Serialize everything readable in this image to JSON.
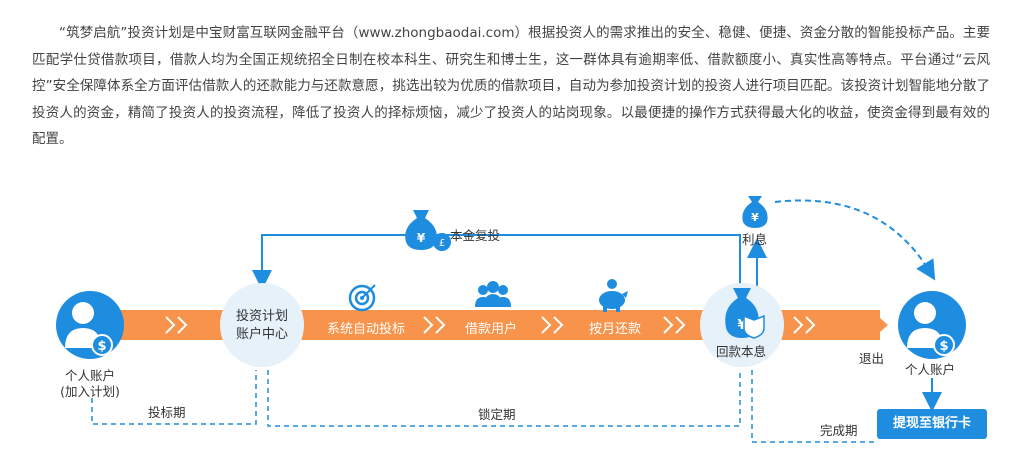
{
  "intro": "“筑梦启航”投资计划是中宝财富互联网金融平台（www.zhongbaodai.com）根据投资人的需求推出的安全、稳健、便捷、资金分散的智能投标产品。主要匹配学仕贷借款项目，借款人均为全国正规统招全日制在校本科生、研究生和博士生，这一群体具有逾期率低、借款额度小、真实性高等特点。平台通过“云风控”安全保障体系全方面评估借款人的还款能力与还款意愿，挑选出较为优质的借款项目，自动为参加投资计划的投资人进行项目匹配。该投资计划智能地分散了投资人的资金，精简了投资人的投资流程，降低了投资人的择标烦恼，减少了投资人的站岗现象。以最便捷的操作方式获得最大化的收益，使资金得到最有效的配置。",
  "diagram": {
    "left_person": {
      "line1": "个人账户",
      "line2": "(加入计划)"
    },
    "center_node": {
      "line1": "投资计划",
      "line2": "账户中心"
    },
    "steps": [
      "系统自动投标",
      "借款用户",
      "按月还款"
    ],
    "return_node": "回款本息",
    "reinvest": "本金复投",
    "interest": "利息",
    "exit": "退出",
    "right_person": "个人账户",
    "bank_button": "提现至银行卡",
    "periods": {
      "bid": "投标期",
      "lock": "锁定期",
      "done": "完成期"
    },
    "icons": [
      "user-dollar-icon",
      "target-icon",
      "users-icon",
      "piggy-bank-icon",
      "money-bag-icon",
      "exit-arrow-icon",
      "shield-icon"
    ],
    "colors": {
      "blue": "#1e8de0",
      "orange": "#f7934a",
      "circle": "#e6f1fa"
    }
  }
}
